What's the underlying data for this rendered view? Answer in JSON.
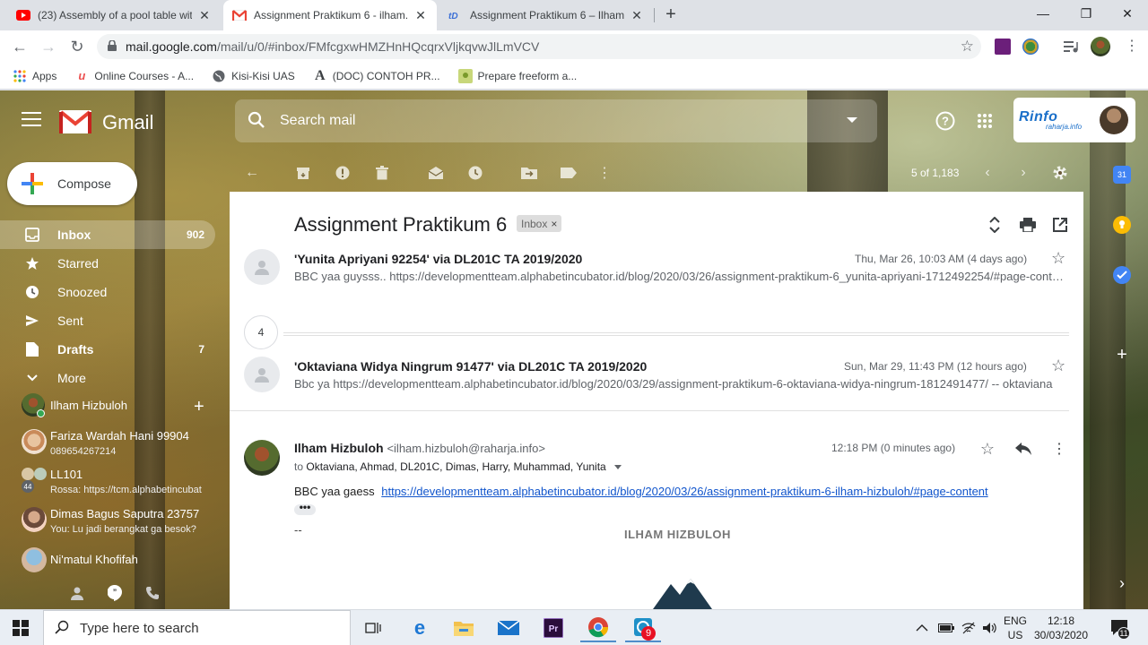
{
  "browser": {
    "tabs": [
      {
        "title": "(23) Assembly of a pool table wit",
        "favicon": "youtube-icon"
      },
      {
        "title": "Assignment Praktikum 6 - ilham.h",
        "favicon": "gmail-icon",
        "active": true
      },
      {
        "title": "Assignment Praktikum 6 – Ilham",
        "favicon": "wordpress-icon"
      }
    ],
    "url_host": "mail.google.com",
    "url_path": "/mail/u/0/#inbox/FMfcgxwHMZHnHQcqrxVljkqvwJlLmVCV",
    "bookmarks": [
      {
        "label": "Apps",
        "icon": "apps-grid-icon"
      },
      {
        "label": "Online Courses - A...",
        "icon": "udemy-icon"
      },
      {
        "label": "Kisi-Kisi UAS",
        "icon": "globe-icon"
      },
      {
        "label": "(DOC) CONTOH PR...",
        "icon": "academia-icon"
      },
      {
        "label": "Prepare freeform a...",
        "icon": "image-icon"
      }
    ]
  },
  "gmail": {
    "logo_text": "Gmail",
    "search_placeholder": "Search mail",
    "compose_label": "Compose",
    "account_logo": {
      "line1": "Rinfo",
      "line2": "raharja.info"
    },
    "nav": [
      {
        "label": "Inbox",
        "count": "902",
        "icon": "inbox-icon",
        "active": true
      },
      {
        "label": "Starred",
        "count": "",
        "icon": "star-icon"
      },
      {
        "label": "Snoozed",
        "count": "",
        "icon": "clock-icon"
      },
      {
        "label": "Sent",
        "count": "",
        "icon": "send-icon"
      },
      {
        "label": "Drafts",
        "count": "7",
        "icon": "draft-icon"
      },
      {
        "label": "More",
        "count": "",
        "icon": "chevron-down-icon"
      }
    ],
    "hangouts_user": "Ilham Hizbuloh",
    "contacts": [
      {
        "name": "Fariza Wardah Hani 99904",
        "sub": "089654267214"
      },
      {
        "name": "LL101",
        "sub": "Rossa: https://tcm.alphabetincubat"
      },
      {
        "name": "Dimas Bagus Saputra 23757",
        "sub": "You: Lu jadi berangkat ga besok?"
      },
      {
        "name": "Ni'matul Khofifah",
        "sub": ""
      }
    ],
    "group_count": "44",
    "pager": "5 of 1,183",
    "thread": {
      "subject": "Assignment Praktikum 6",
      "label_chip": "Inbox",
      "messages": [
        {
          "from": "'Yunita Apriyani 92254' via DL201C TA 2019/2020",
          "date": "Thu, Mar 26, 10:03 AM (4 days ago)",
          "snippet": "BBC yaa guysss.. https://developmentteam.alphabetincubator.id/blog/2020/03/26/assignment-praktikum-6_yunita-apriyani-1712492254/#page-content --"
        },
        {
          "from": "'Oktaviana Widya Ningrum 91477' via DL201C TA 2019/2020",
          "date": "Sun, Mar 29, 11:43 PM (12 hours ago)",
          "snippet": "Bbc ya https://developmentteam.alphabetincubator.id/blog/2020/03/29/assignment-praktikum-6-oktaviana-widya-ningrum-1812491477/ -- oktaviana"
        }
      ],
      "collapsed_count": "4",
      "expanded": {
        "from_name": "Ilham Hizbuloh",
        "from_email": "<ilham.hizbuloh@raharja.info>",
        "date": "12:18 PM (0 minutes ago)",
        "to_prefix": "to",
        "to_list": "Oktaviana, Ahmad, DL201C, Dimas, Harry, Muhammad, Yunita",
        "body_text": "BBC yaa gaess",
        "body_link": "https://developmentteam.alphabetincubator.id/blog/2020/03/26/assignment-praktikum-6-ilham-hizbuloh/#page-content",
        "ellipsis": "•••",
        "sig_dash": "--",
        "signature_name": "ILHAM HIZBULOH"
      }
    }
  },
  "taskbar": {
    "search_placeholder": "Type here to search",
    "lang_top": "ENG",
    "lang_bottom": "US",
    "time": "12:18",
    "date": "30/03/2020",
    "notification_badge": "11",
    "app_badge": "9"
  },
  "colors": {
    "accent_blue": "#1a73e8",
    "gmail_red": "#ea4335",
    "link": "#1155cc"
  }
}
